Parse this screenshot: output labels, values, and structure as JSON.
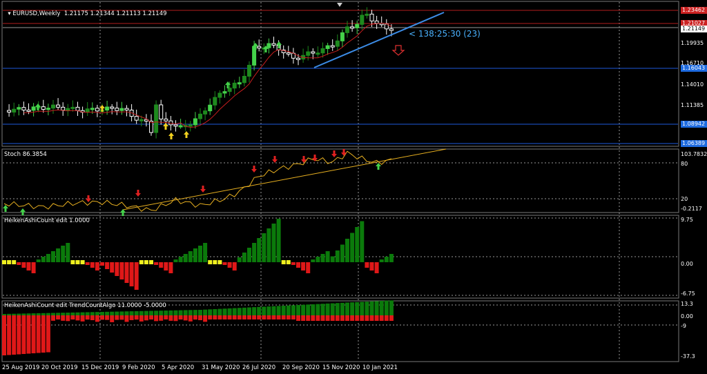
{
  "colors": {
    "background": "#000000",
    "bull": "#1e8a1e",
    "bull_bright": "#44d24a",
    "bear": "#ffffff",
    "ma": "#c81e1e",
    "trend": "#3c8ce6",
    "stoch": "#e8b020",
    "hline_blue": "#1e5adc",
    "hline_red": "#b41e1e",
    "hist_green": "#0b7a0b",
    "hist_red": "#e01818",
    "hist_yellow": "#f0f020",
    "grid": "#9a9a9a",
    "tag_red": "#cc2222",
    "tag_blue": "#1e6be0"
  },
  "main": {
    "title": "EURUSD,Weekly  1.21175 1.21344 1.21113 1.21149",
    "title_icon": "triangle-down-icon",
    "timer": "< 138:25:30 (23)",
    "down_arrow_icon": "outline-arrow-down-icon",
    "y_ticks": [
      "1.19935",
      "1.16710",
      "1.14010",
      "1.11385",
      "1.06389"
    ],
    "price_tags": [
      {
        "text": "1.23462",
        "color": "#cc2222"
      },
      {
        "text": "1.21027",
        "color": "#cc2222"
      },
      {
        "text": "1.21149",
        "color": "#ffffff"
      },
      {
        "text": "1.16043",
        "color": "#1e6be0"
      },
      {
        "text": "1.08942",
        "color": "#1e6be0"
      },
      {
        "text": "1.06389",
        "color": "#1e6be0"
      }
    ]
  },
  "stoch": {
    "title": "Stoch 86.3854",
    "y_ticks": [
      "103.7832",
      "80",
      "20",
      "-0.2117"
    ]
  },
  "hac": {
    "title": "HeikenAshiCount edit 1.0000",
    "y_ticks": [
      "9.75",
      "0.00",
      "-6.75"
    ]
  },
  "hac_trend": {
    "title": "HeikenAshiCount edit TrendCountAlgo 11.0000 -5.0000",
    "y_ticks": [
      "13.3",
      "0.00",
      "-9",
      "-37.3"
    ]
  },
  "x_axis": {
    "labels": [
      "25 Aug 2019",
      "20 Oct 2019",
      "15 Dec 2019",
      "9 Feb 2020",
      "5 Apr 2020",
      "31 May 2020",
      "26 Jul 2020",
      "20 Sep 2020",
      "15 Nov 2020",
      "10 Jan 2021"
    ]
  }
}
